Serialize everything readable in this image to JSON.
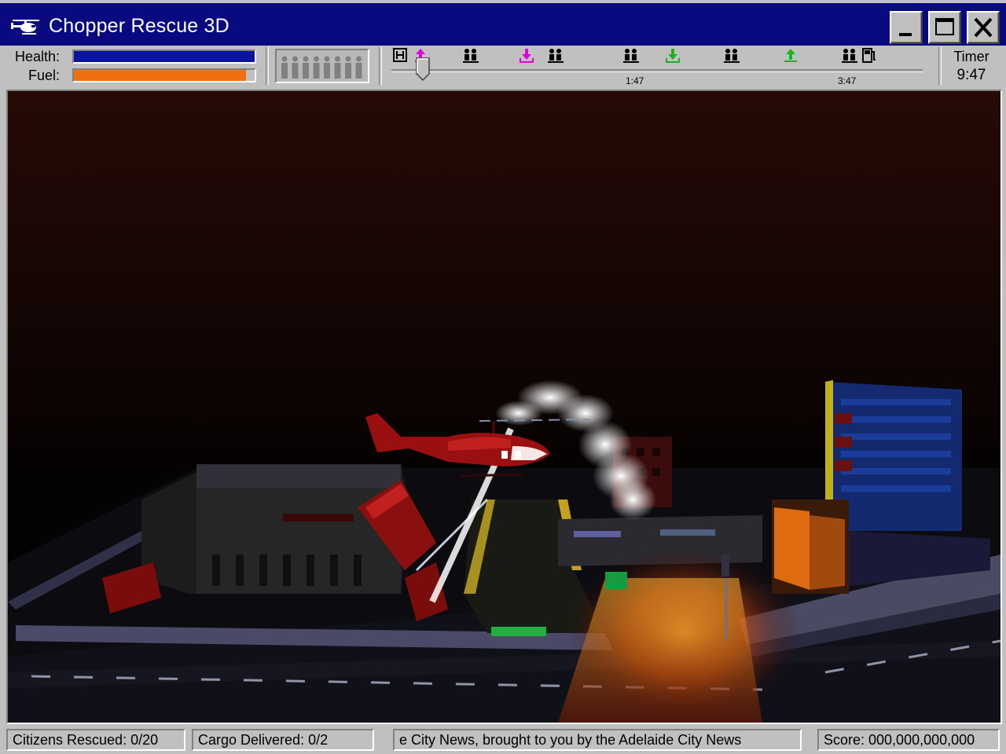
{
  "window": {
    "title": "Chopper Rescue 3D",
    "icon": "helicopter-icon",
    "controls": [
      "minimize-icon",
      "maximize-icon",
      "close-icon"
    ]
  },
  "hud": {
    "health_label": "Health:",
    "health_level": 1.0,
    "fuel_label": "Fuel:",
    "fuel_level": 0.95,
    "passenger_slots": 8,
    "timeline": {
      "markers": [
        {
          "icon": "helipad-icon",
          "color": "#000000"
        },
        {
          "icon": "upload-arrow-icon",
          "color": "#e000e0"
        },
        {
          "icon": "people-icon",
          "color": "#000000"
        },
        {
          "icon": "download-arrow-icon",
          "color": "#e000e0"
        },
        {
          "icon": "people-icon",
          "color": "#000000"
        },
        {
          "icon": "people-icon",
          "color": "#000000"
        },
        {
          "icon": "download-arrow-icon",
          "color": "#20b020"
        },
        {
          "icon": "people-icon",
          "color": "#000000"
        },
        {
          "icon": "upload-arrow-icon",
          "color": "#20b020"
        },
        {
          "icon": "people-icon",
          "color": "#000000"
        },
        {
          "icon": "fuel-pump-icon",
          "color": "#000000"
        }
      ],
      "time_labels": [
        "1:47",
        "3:47"
      ]
    },
    "timer_label": "Timer",
    "timer_value": "9:47"
  },
  "status": {
    "citizens": "Citizens Rescued: 0/20",
    "cargo": "Cargo Delivered: 0/2",
    "news": "e City News, brought to you by the Adelaide City News",
    "score": "Score: 000,000,000,000"
  },
  "colors": {
    "titlebar": "#0a0a80",
    "health": "#0a14a0",
    "fuel": "#f07010",
    "chrome": "#c0c0c0"
  }
}
